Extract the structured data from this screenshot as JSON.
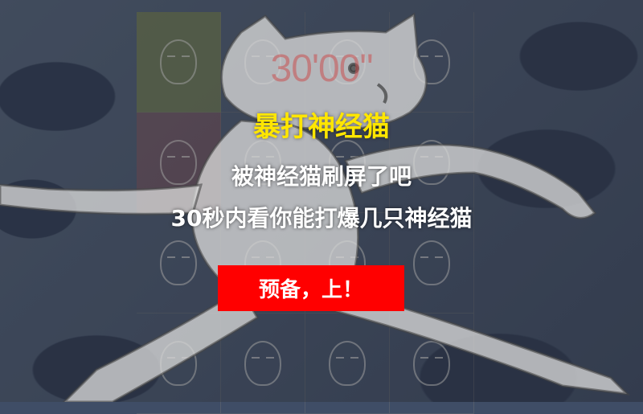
{
  "game": {
    "timer": "30'00\"",
    "title": "暴打神经猫",
    "subtitle_line1": "被神经猫刷屏了吧",
    "subtitle_line2": "30秒内看你能打爆几只神经猫",
    "start_button": "预备，上！"
  },
  "colors": {
    "title": "#ffe600",
    "button": "#ff0000",
    "timer": "#c85050"
  },
  "icons": [
    "meme-face-icon",
    "cat-figure-icon"
  ]
}
